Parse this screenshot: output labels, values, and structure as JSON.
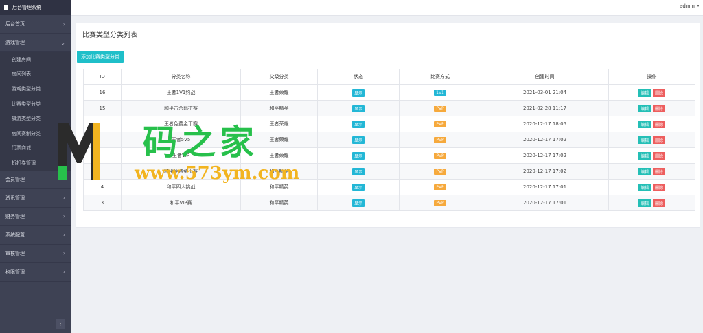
{
  "sidebar": {
    "brand": "后台管理系统",
    "items": [
      {
        "label": "后台首页",
        "chev": "›"
      },
      {
        "label": "游戏管理",
        "chev": "⌄"
      },
      {
        "label": "会员管理",
        "chev": ""
      },
      {
        "label": "资讯管理",
        "chev": "›"
      },
      {
        "label": "财务管理",
        "chev": "›"
      },
      {
        "label": "系统配置",
        "chev": "›"
      },
      {
        "label": "审核管理",
        "chev": "›"
      },
      {
        "label": "权限管理",
        "chev": "›"
      }
    ],
    "sub_items": [
      "创建房间",
      "房间列表",
      "游戏类型分类",
      "比赛类型分类",
      "旗游类型分类",
      "房间赛制分类",
      "门票商城",
      "折扣卷管理"
    ],
    "collapse": "‹"
  },
  "topbar": {
    "user": "admin",
    "caret": "▾"
  },
  "panel": {
    "title": "比赛类型分类列表",
    "add_button": "添加比赛类型分类"
  },
  "table": {
    "headers": [
      "ID",
      "分类名称",
      "父级分类",
      "状态",
      "比赛方式",
      "创建时间",
      "操作"
    ],
    "rows": [
      {
        "id": "16",
        "name": "王者1V1约战",
        "parent": "王者荣耀",
        "status": "显示",
        "mode": "1V1",
        "created": "2021-03-01 21:04"
      },
      {
        "id": "15",
        "name": "和平击杀比拼赛",
        "parent": "和平精英",
        "status": "显示",
        "mode": "PVP",
        "created": "2021-02-28 11:17"
      },
      {
        "id": "",
        "name": "王者免费金币赛",
        "parent": "王者荣耀",
        "status": "显示",
        "mode": "PVP",
        "created": "2020-12-17 18:05"
      },
      {
        "id": "",
        "name": "王者5V5",
        "parent": "王者荣耀",
        "status": "显示",
        "mode": "PVP",
        "created": "2020-12-17 17:02"
      },
      {
        "id": "",
        "name": "王者VIP",
        "parent": "王者荣耀",
        "status": "显示",
        "mode": "PVP",
        "created": "2020-12-17 17:02"
      },
      {
        "id": "",
        "name": "和平免费金币赛",
        "parent": "和平精英",
        "status": "显示",
        "mode": "PVP",
        "created": "2020-12-17 17:02"
      },
      {
        "id": "4",
        "name": "和平四人挑战",
        "parent": "和平精英",
        "status": "显示",
        "mode": "PVP",
        "created": "2020-12-17 17:01"
      },
      {
        "id": "3",
        "name": "和平VIP赛",
        "parent": "和平精英",
        "status": "显示",
        "mode": "PVP",
        "created": "2020-12-17 17:01"
      }
    ],
    "edit_label": "编辑",
    "delete_label": "删除"
  },
  "watermark": {
    "text1": "码之家",
    "text2": "www.573ym.com",
    "logo_letter": "M"
  },
  "colors": {
    "sidebar": "#3e4254",
    "accent": "#1fbfc9",
    "pvp": "#f6a93c",
    "danger": "#ed5e5e"
  }
}
